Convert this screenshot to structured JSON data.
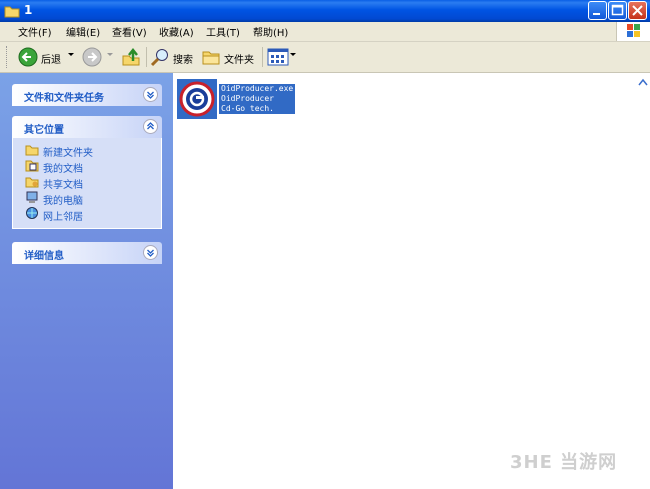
{
  "window": {
    "title": "1"
  },
  "menu": [
    {
      "label": "文件(F)"
    },
    {
      "label": "编辑(E)"
    },
    {
      "label": "查看(V)"
    },
    {
      "label": "收藏(A)"
    },
    {
      "label": "工具(T)"
    },
    {
      "label": "帮助(H)"
    }
  ],
  "toolbar": {
    "back_label": "后退",
    "search_label": "搜索",
    "folders_label": "文件夹"
  },
  "taskpane": {
    "file_tasks_title": "文件和文件夹任务",
    "other_places_title": "其它位置",
    "other_places": [
      {
        "label": "新建文件夹",
        "icon": "folder-icon"
      },
      {
        "label": "我的文档",
        "icon": "documents-icon"
      },
      {
        "label": "共享文档",
        "icon": "shared-folder-icon"
      },
      {
        "label": "我的电脑",
        "icon": "computer-icon"
      },
      {
        "label": "网上邻居",
        "icon": "network-icon"
      }
    ],
    "details_title": "详细信息"
  },
  "files": [
    {
      "name": "OidProducer.exe",
      "description": "OidProducer",
      "company": "Cd-Go tech."
    }
  ],
  "watermark": "3HE 当游网"
}
